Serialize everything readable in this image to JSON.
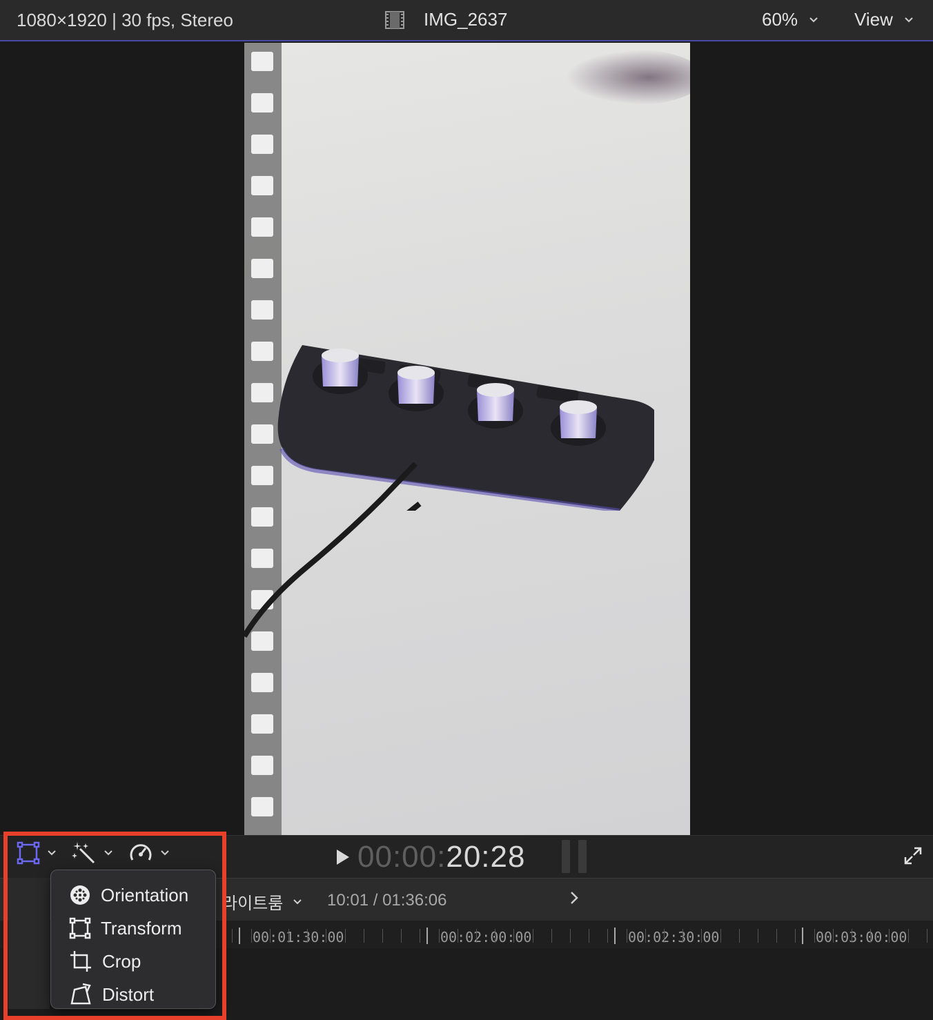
{
  "topbar": {
    "format": "1080×1920 | 30 fps, Stereo",
    "clip_name": "IMG_2637",
    "zoom": "60%",
    "view": "View"
  },
  "controls": {
    "timecode_dim": "00:00:",
    "timecode_bright": "20:28"
  },
  "timeline": {
    "project_name": "라이트룸",
    "duration": "10:01 / 01:36:06",
    "ruler_labels": [
      "00:01:30:00",
      "00:02:00:00",
      "00:02:30:00",
      "00:03:00:00"
    ]
  },
  "menu": {
    "items": [
      {
        "label": "Orientation",
        "icon": "orientation-icon"
      },
      {
        "label": "Transform",
        "icon": "transform-icon"
      },
      {
        "label": "Crop",
        "icon": "crop-icon"
      },
      {
        "label": "Distort",
        "icon": "distort-icon"
      }
    ]
  },
  "colors": {
    "accent": "#5e5ce6",
    "highlight": "#e8402a"
  }
}
